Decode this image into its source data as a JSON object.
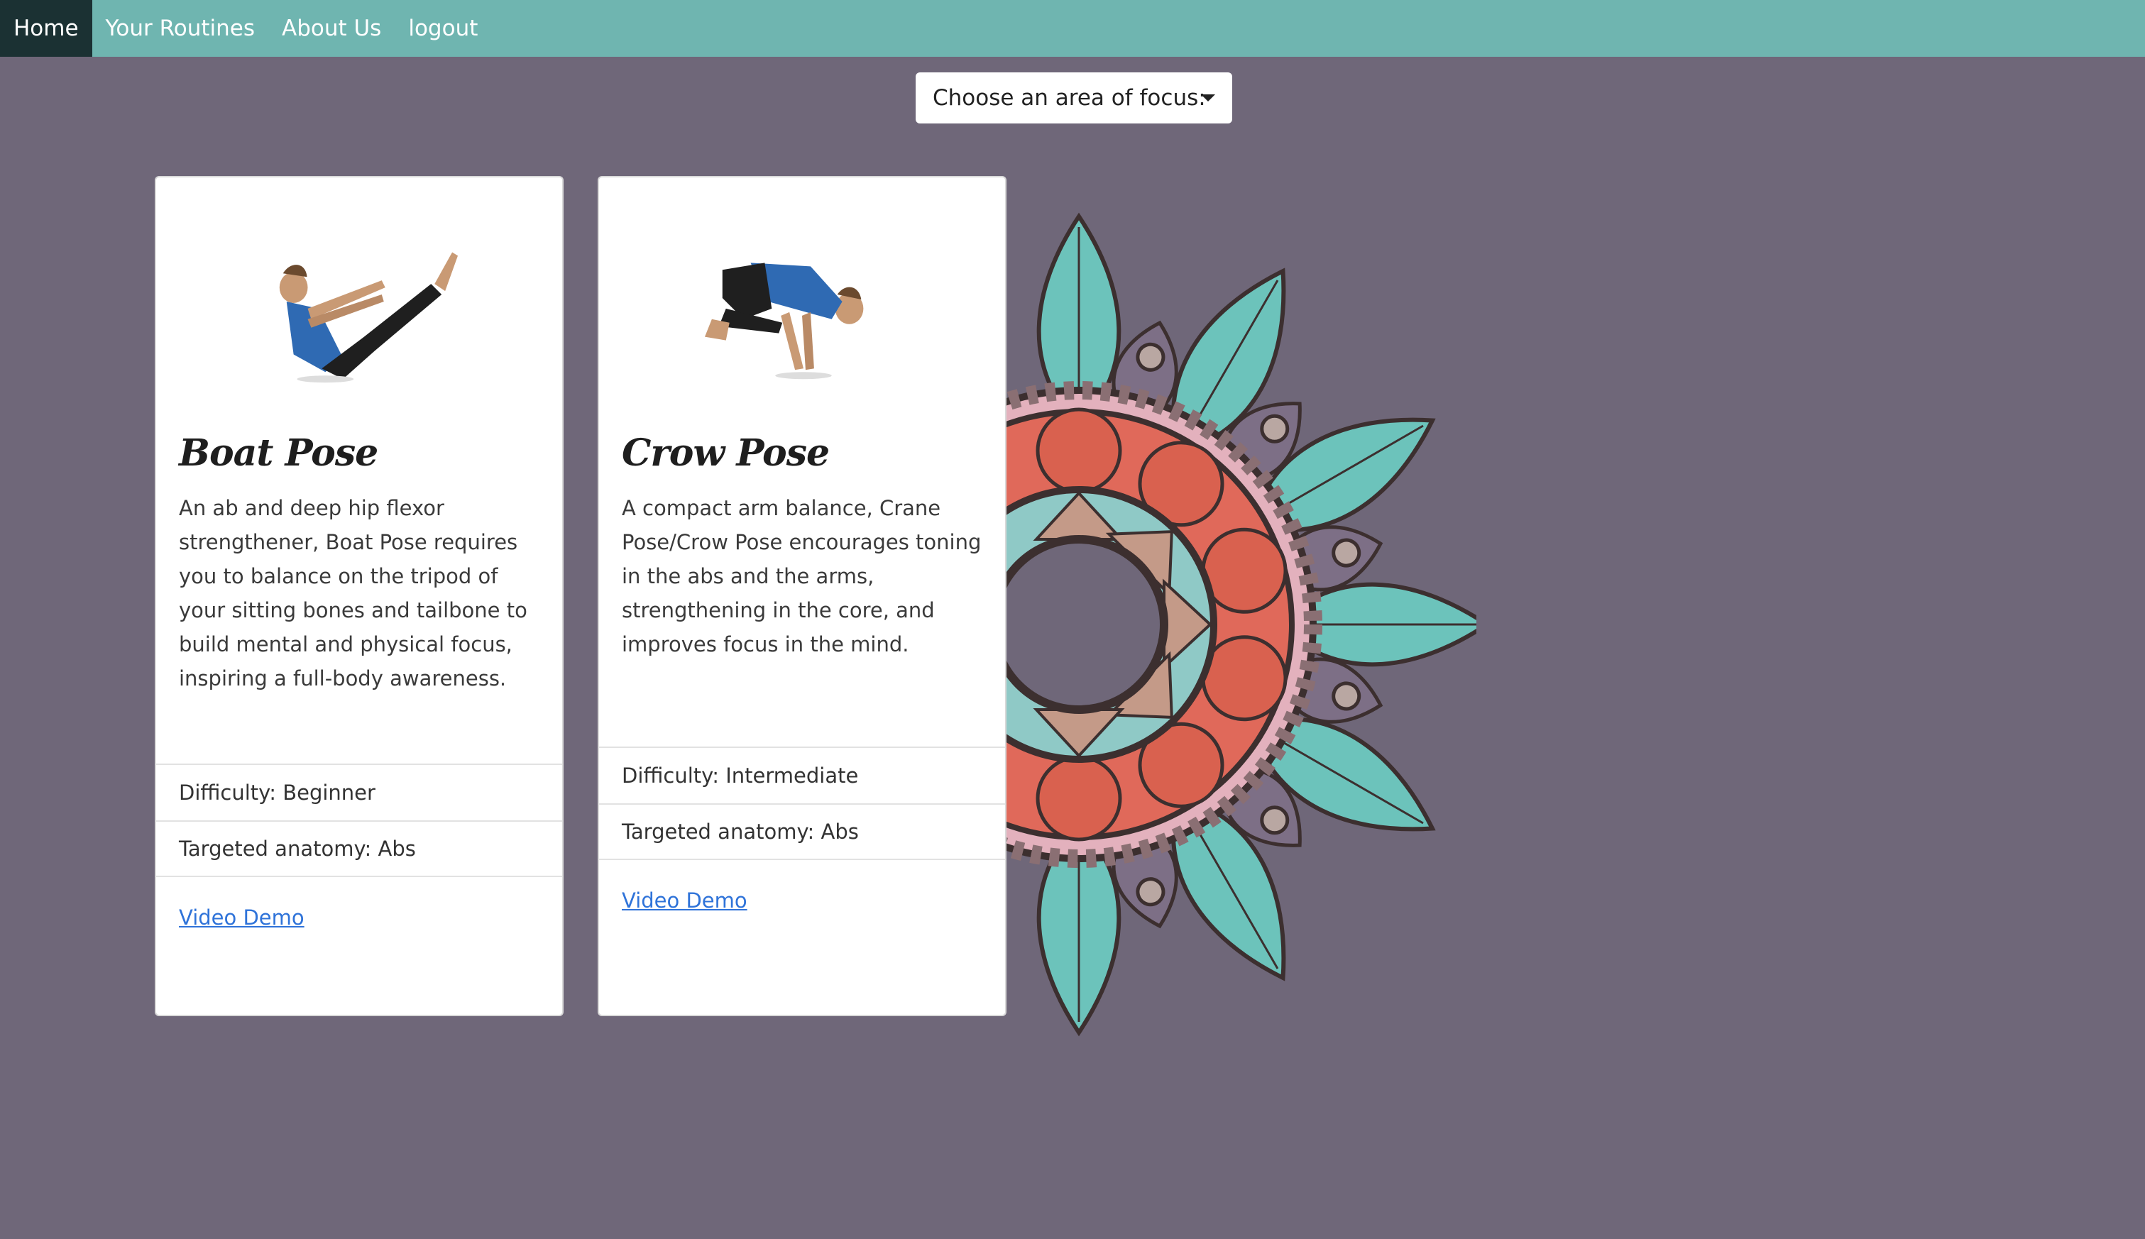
{
  "nav": {
    "items": [
      {
        "label": "Home",
        "active": true
      },
      {
        "label": "Your Routines",
        "active": false
      },
      {
        "label": "About Us",
        "active": false
      },
      {
        "label": "logout",
        "active": false
      }
    ]
  },
  "focus_dropdown": {
    "label": "Choose an area of focus:"
  },
  "cards": [
    {
      "title": "Boat Pose",
      "description": "An ab and deep hip flexor strengthener, Boat Pose requires you to balance on the tripod of your sitting bones and tailbone to build mental and physical focus, inspiring a full-body awareness.",
      "difficulty": "Difficulty: Beginner",
      "anatomy": "Targeted anatomy: Abs",
      "link": "Video Demo"
    },
    {
      "title": "Crow Pose",
      "description": "A compact arm balance, Crane Pose/Crow Pose encourages toning in the abs and the arms, strengthening in the core, and improves focus in the mind.",
      "difficulty": "Difficulty: Intermediate",
      "anatomy": "Targeted anatomy: Abs",
      "link": "Video Demo"
    }
  ],
  "colors": {
    "background": "#6f6779",
    "navbar": "#6fb5b0",
    "nav_active": "#1b3133",
    "link": "#2f73d9",
    "mandala_teal": "#6cc3bb",
    "mandala_coral": "#e0695a",
    "mandala_pink": "#e3b1bd"
  }
}
